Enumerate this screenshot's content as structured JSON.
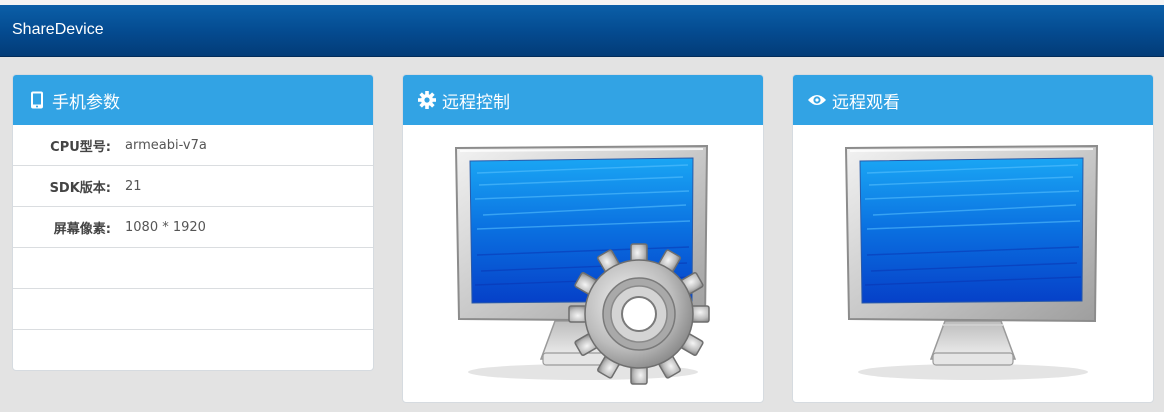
{
  "app": {
    "brand": "ShareDevice"
  },
  "panels": {
    "params": {
      "title": "手机参数",
      "icon": "mobile-phone-icon",
      "rows": [
        {
          "label": "CPU型号:",
          "value": "armeabi-v7a"
        },
        {
          "label": "SDK版本:",
          "value": "21"
        },
        {
          "label": "屏幕像素:",
          "value": "1080 * 1920"
        },
        {
          "label": "",
          "value": ""
        },
        {
          "label": "",
          "value": ""
        },
        {
          "label": "",
          "value": ""
        }
      ]
    },
    "remote_control": {
      "title": "远程控制",
      "icon": "gear-icon",
      "image": "monitor-with-gear"
    },
    "remote_view": {
      "title": "远程观看",
      "icon": "eye-icon",
      "image": "monitor"
    }
  },
  "colors": {
    "navbar": "#044a8f",
    "panel_heading": "#32a3e4",
    "background": "#e3e3e3",
    "screen_blue": "#1a7de0"
  }
}
